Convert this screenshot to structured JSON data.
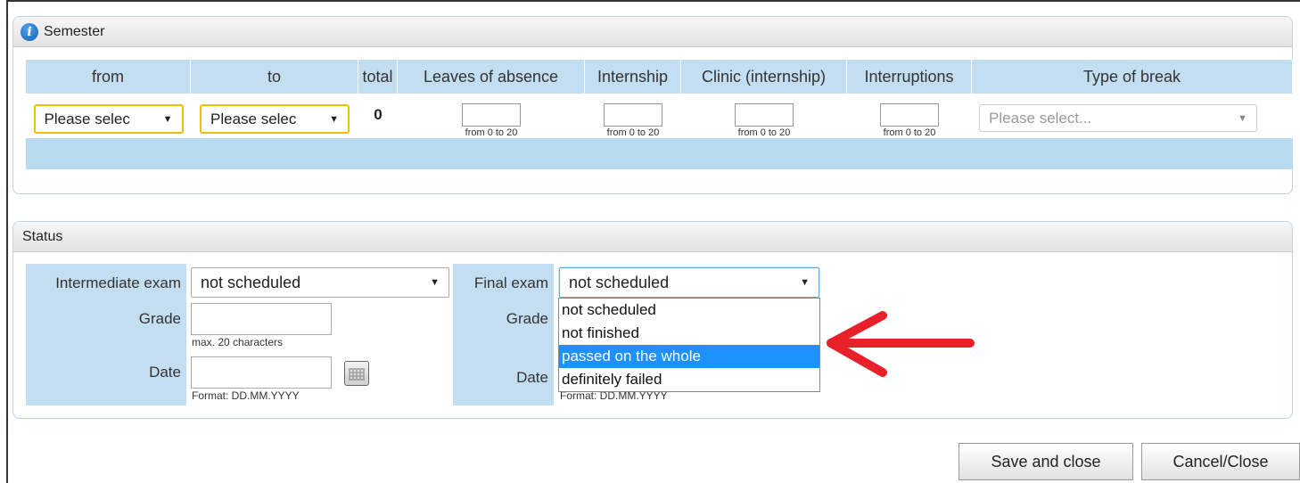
{
  "semester": {
    "title": "Semester",
    "columns": [
      "from",
      "to",
      "total",
      "Leaves of absence",
      "Internship",
      "Clinic (internship)",
      "Interruptions",
      "Type of break"
    ],
    "from_value": "Please selec",
    "to_value": "Please selec",
    "total_value": "0",
    "range_hint": "from 0 to 20",
    "type_placeholder": "Please select..."
  },
  "status": {
    "title": "Status",
    "intermediate_label": "Intermediate exam",
    "intermediate_value": "not scheduled",
    "final_label": "Final exam",
    "final_value": "not scheduled",
    "grade_label": "Grade",
    "grade_hint": "max. 20 characters",
    "date_label": "Date",
    "date_hint": "Format: DD.MM.YYYY",
    "final_options": [
      "not scheduled",
      "not finished",
      "passed on the whole",
      "definitely failed"
    ],
    "highlighted_option": "passed on the whole"
  },
  "buttons": {
    "save": "Save and close",
    "cancel": "Cancel/Close"
  },
  "colors": {
    "header_blue": "#c4def1",
    "focus_yellow": "#f0c000",
    "highlight": "#1e90ff",
    "arrow": "#e8202a"
  }
}
